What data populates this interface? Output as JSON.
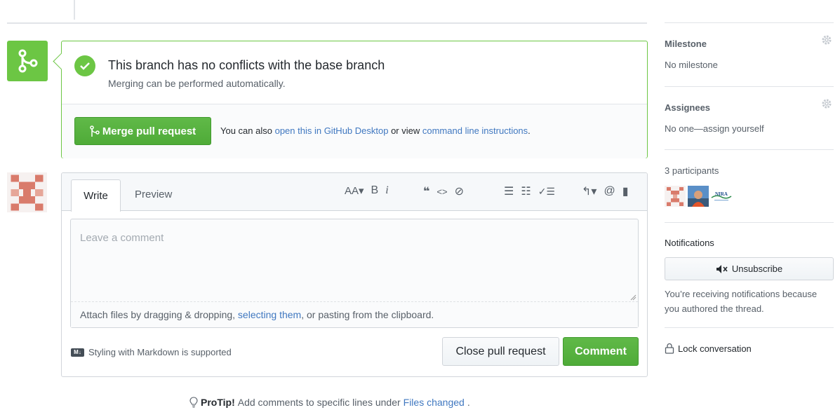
{
  "merge": {
    "title": "This branch has no conflicts with the base branch",
    "subtitle": "Merging can be performed automatically.",
    "button_label": "Merge pull request",
    "alt_prefix": "You can also ",
    "alt_link1": "open this in GitHub Desktop",
    "alt_middle": " or view ",
    "alt_link2": "command line instructions",
    "alt_suffix": ".",
    "accent": "#6cc644"
  },
  "comment": {
    "tabs": [
      {
        "label": "Write"
      },
      {
        "label": "Preview"
      }
    ],
    "toolbar": {
      "heading": "AA▾",
      "bold": "B",
      "italic": "i",
      "quote": "❝",
      "code": "<>",
      "link": "⊘",
      "ul": "☰",
      "ol": "☷",
      "tasks": "✓☰",
      "reply": "↰▾",
      "mention": "@",
      "bookmark": "▮"
    },
    "placeholder": "Leave a comment",
    "attach_prefix": "Attach files by dragging & dropping, ",
    "attach_link": "selecting them",
    "attach_suffix": ", or pasting from the clipboard.",
    "markdown_note": "Styling with Markdown is supported",
    "markdown_badge": "M↓",
    "close_button": "Close pull request",
    "comment_button": "Comment"
  },
  "protip": {
    "bold": "ProTip!",
    "text": " Add comments to specific lines under ",
    "link": "Files changed",
    "suffix": "."
  },
  "sidebar": {
    "milestone": {
      "heading": "Milestone",
      "value": "No milestone"
    },
    "assignees": {
      "heading": "Assignees",
      "value": "No one—assign yourself"
    },
    "participants": {
      "heading": "3 participants",
      "avatar_text": "NIRA"
    },
    "notifications": {
      "heading": "Notifications",
      "button": "Unsubscribe",
      "reason": "You’re receiving notifications because you authored the thread."
    },
    "lock": {
      "label": "Lock conversation"
    }
  }
}
